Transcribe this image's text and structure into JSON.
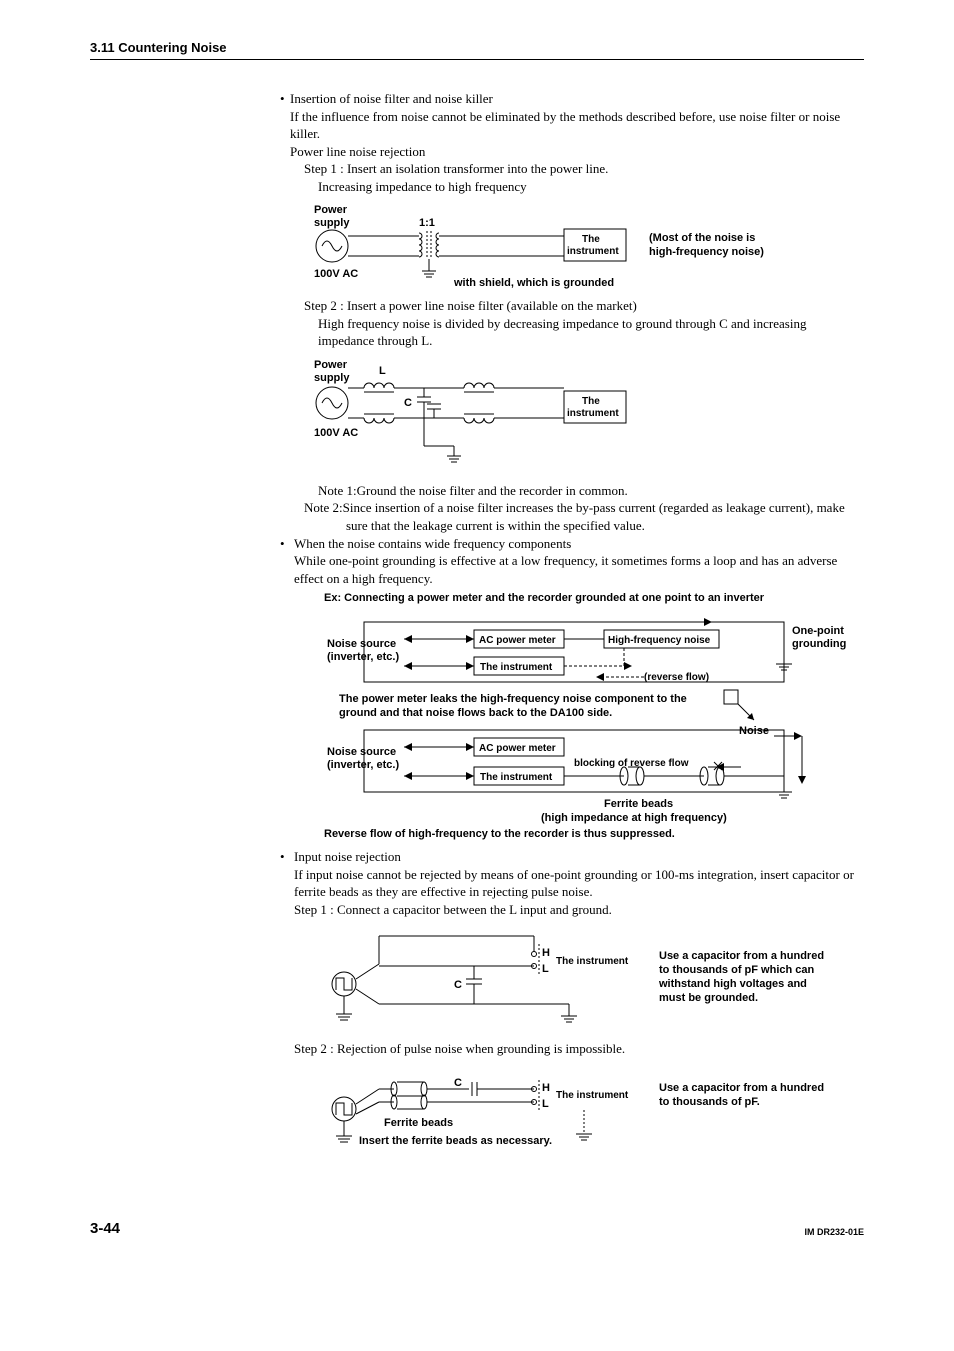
{
  "header": "3.11  Countering Noise",
  "s1": {
    "bullet": "•",
    "title": "Insertion of noise filter and noise killer",
    "p1": "If the influence from noise cannot be eliminated by the methods described before, use noise filter or noise killer.",
    "p2": "Power line noise rejection",
    "step1_title": "Step 1 : Insert an isolation transformer into the power line.",
    "step1_sub": "Increasing impedance to high frequency",
    "fig1": {
      "power_supply": "Power supply",
      "ratio": "1:1",
      "voltage": "100V AC",
      "instrument": "The instrument",
      "shield_note": "with shield, which is grounded",
      "right_note1": "(Most of the noise is",
      "right_note2": "high-frequency noise)"
    },
    "step2_title": "Step 2 :  Insert a power line noise filter (available on the market)",
    "step2_sub": "High frequency noise is divided by decreasing impedance to ground through C and increasing impedance through L.",
    "fig2": {
      "power_supply": "Power supply",
      "L": "L",
      "C": "C",
      "voltage": "100V AC",
      "instrument": "The instrument"
    },
    "note1": "Note 1:Ground the noise filter and the recorder in common.",
    "note2": "Note 2:Since insertion of a noise filter increases the by-pass current (regarded as leakage current), make sure that the leakage current is within the specified value."
  },
  "s2": {
    "bullet": "•",
    "title": "When the noise contains wide frequency components",
    "p1": "While one-point grounding is effective at a low frequency, it sometimes forms a loop and has an adverse effect on a high frequency.",
    "ex_title": "Ex: Connecting a power meter and the recorder grounded at one point to an inverter",
    "fig3": {
      "noise_source1": "Noise source",
      "noise_source2": "(inverter, etc.)",
      "acmeter": "AC power meter",
      "instrument": "The instrument",
      "hfnoise": "High-frequency noise",
      "onepoint": "One-point grounding",
      "revflow": "(reverse flow)",
      "mid_note1": "The power meter leaks the high-frequency noise component to the",
      "mid_note2": "ground and that noise flows back to the DA100 side.",
      "noise": "Noise",
      "blocking": "blocking of reverse flow",
      "ferrite1": "Ferrite beads",
      "ferrite2": "(high impedance at high frequency)",
      "bottom": "Reverse flow of high-frequency to the recorder is thus suppressed."
    }
  },
  "s3": {
    "bullet": "•",
    "title": "Input noise rejection",
    "p1": "If input noise cannot be rejected by means of one-point grounding or 100-ms integration, insert capacitor or ferrite beads as they are effective in rejecting pulse noise.",
    "step1": "Step 1 : Connect a capacitor between the L input and ground.",
    "fig4": {
      "H": "H",
      "L": "L",
      "C": "C",
      "instrument": "The instrument",
      "note": "Use a capacitor from a hundred to thousands of pF which can withstand high voltages and must be grounded."
    },
    "step2": "Step 2 : Rejection of pulse noise when grounding is impossible.",
    "fig5": {
      "H": "H",
      "L": "L",
      "C": "C",
      "instrument": "The instrument",
      "ferrite": "Ferrite beads",
      "insert": "Insert the ferrite beads as necessary.",
      "note": "Use a capacitor from a hundred to thousands of pF."
    }
  },
  "footer": {
    "page": "3-44",
    "doc": "IM DR232-01E"
  }
}
